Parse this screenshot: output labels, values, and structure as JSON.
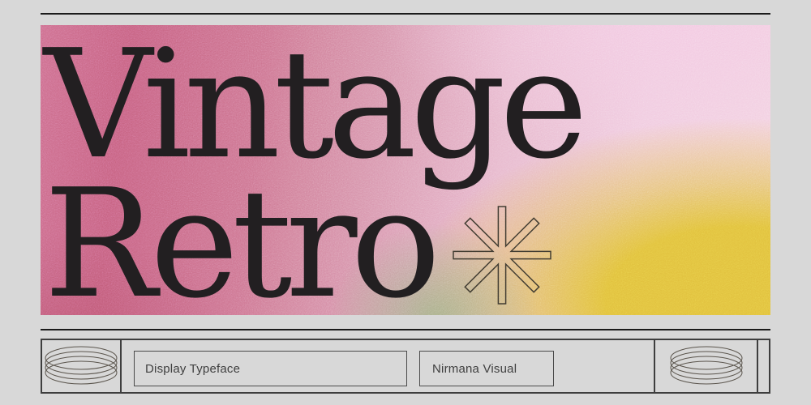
{
  "poster": {
    "title_line1": "Vintage",
    "title_line2": "Retro",
    "asterisk_icon": "8-point-asterisk-outline"
  },
  "footer": {
    "typeface_label": "Display Typeface",
    "author_label": "Nirmana Visual",
    "left_icon": "cylinder-rings",
    "right_icon": "cylinder-rings"
  },
  "colors": {
    "page_bg": "#d8d8d8",
    "rule": "#1b1b1b",
    "title_text": "#221f21",
    "label_text": "#3f3f3f",
    "box_border": "#3e3e3e",
    "gradient_rose": "#c9688a",
    "gradient_pink_light": "#f3d2e2",
    "gradient_yellow": "#e0bf38",
    "gradient_green": "#9cb187"
  }
}
